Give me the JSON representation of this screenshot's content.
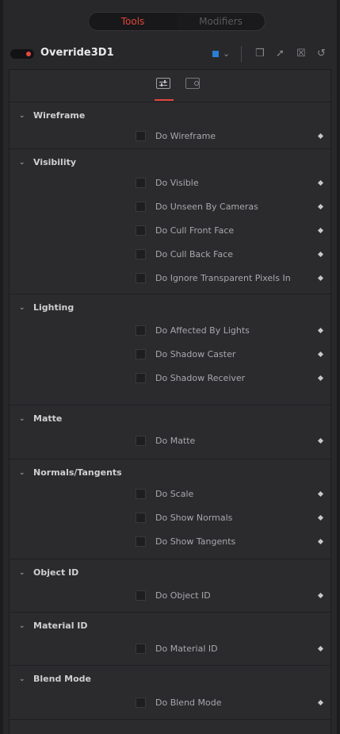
{
  "top_tabs": {
    "tools": "Tools",
    "modifiers": "Modifiers"
  },
  "node": {
    "title": "Override3D1",
    "color_chip": "#2a7fd4"
  },
  "header_icons": [
    "chevron-down-icon",
    "window-icon",
    "pin-icon",
    "lock-icon",
    "reset-icon"
  ],
  "subtabs": [
    "controls-tab",
    "settings-tab"
  ],
  "accent_color": "#e0463c",
  "sections": [
    {
      "title": "Wireframe",
      "rows": [
        "Do Wireframe"
      ]
    },
    {
      "title": "Visibility",
      "rows": [
        "Do Visible",
        "Do Unseen By Cameras",
        "Do Cull Front Face",
        "Do Cull Back Face",
        "Do Ignore Transparent Pixels In"
      ]
    },
    {
      "title": "Lighting",
      "rows": [
        "Do Affected By Lights",
        "Do Shadow Caster",
        "Do Shadow Receiver"
      ]
    },
    {
      "title": "Matte",
      "rows": [
        "Do Matte"
      ]
    },
    {
      "title": "Normals/Tangents",
      "rows": [
        "Do Scale",
        "Do Show Normals",
        "Do Show Tangents"
      ]
    },
    {
      "title": "Object ID",
      "rows": [
        "Do Object ID"
      ]
    },
    {
      "title": "Material ID",
      "rows": [
        "Do Material ID"
      ]
    },
    {
      "title": "Blend Mode",
      "rows": [
        "Do Blend Mode"
      ]
    }
  ]
}
